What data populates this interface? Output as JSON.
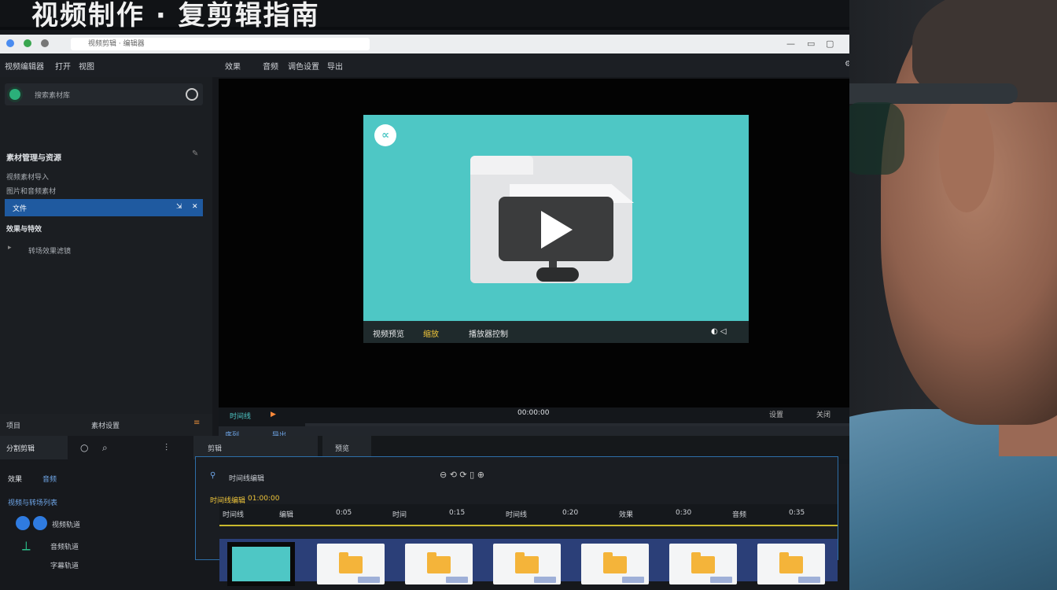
{
  "banner": {
    "title": "视频制作 · 复剪辑指南"
  },
  "browser": {
    "tab_title": "视频剪辑 · 编辑器"
  },
  "menu": {
    "items": [
      "视频编辑器",
      "打开",
      "视图"
    ],
    "center_items": [
      "效果",
      "音频",
      "调色设置",
      "导出"
    ]
  },
  "left_panel": {
    "search_placeholder": "搜索素材库",
    "section_title": "素材管理与资源",
    "items": [
      "视频素材导入",
      "图片和音频素材"
    ],
    "selected_item": "文件",
    "section2_title": "效果与特效",
    "sub_item": "转场效果滤镜"
  },
  "preview": {
    "logo_text": "∝",
    "bar_left": "视频预览",
    "bar_mid": "缩放",
    "bar_right": "播放器控制",
    "bar_icons": "◐ ◁"
  },
  "transport": {
    "label_left": "时间线",
    "timecode": "00:00:00",
    "row_labels": [
      "序列",
      "导出"
    ],
    "right_labels": [
      "设置",
      "关闭"
    ]
  },
  "left_footer": {
    "left": "项目",
    "mid": "素材设置",
    "right": "≡"
  },
  "bottom_left": {
    "tab_main": "分割剪辑",
    "header_a": "效果",
    "header_b": "音频",
    "header_c": "视频与转场列表",
    "rows": [
      "视频轨道",
      "音频轨道",
      "字幕轨道"
    ]
  },
  "tabs": [
    "剪辑",
    "预览"
  ],
  "timeline": {
    "title": "时间线编辑",
    "label_a": "时间线编辑",
    "label_b": "01:00:00",
    "ruler": [
      "时间线",
      "编辑",
      "0:05",
      "时间",
      "0:15",
      "时间线",
      "0:20",
      "效果",
      "0:30",
      "音频",
      "0:35"
    ],
    "clip_count": 7
  },
  "colors": {
    "accent": "#1f5aa0",
    "preview_teal": "#4ec7c5",
    "timeline_border": "#2d6ea8",
    "folder_yellow": "#f4b43a",
    "track_blue": "#2b3f78"
  },
  "icons": [
    "search-icon",
    "play-icon",
    "folder-icon",
    "gear-icon",
    "close-icon",
    "speaker-icon"
  ]
}
